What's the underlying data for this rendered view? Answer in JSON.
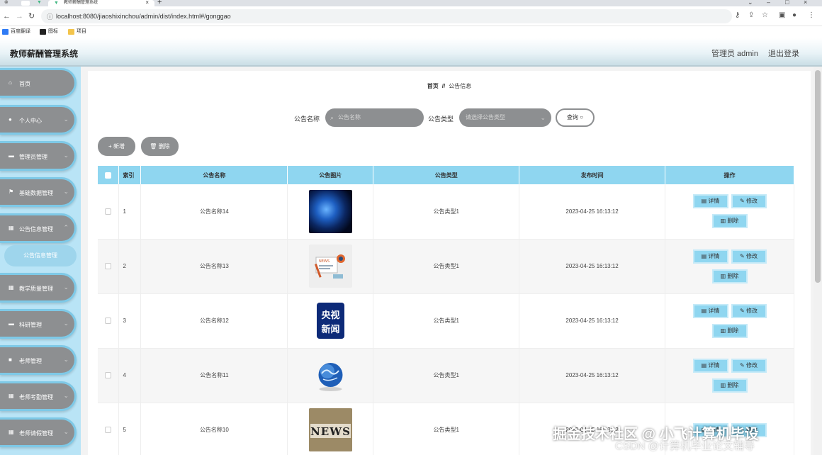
{
  "browser": {
    "tab_title": "教师薪酬管理系统",
    "url": "localhost:8080/jiaoshixinchou/admin/dist/index.html#/gonggao",
    "bookmarks": [
      "百度翻译",
      "图标",
      "项目"
    ]
  },
  "header": {
    "title": "教师薪酬管理系统",
    "admin_label": "管理员 admin",
    "logout_label": "退出登录"
  },
  "sidebar": {
    "items": [
      {
        "label": "首页",
        "icon": "home-icon"
      },
      {
        "label": "个人中心",
        "icon": "user-icon"
      },
      {
        "label": "管理员管理",
        "icon": "monitor-icon"
      },
      {
        "label": "基础数据管理",
        "icon": "flag-icon"
      },
      {
        "label": "公告信息管理",
        "icon": "grid-icon"
      },
      {
        "label": "教学质量管理",
        "icon": "grid-icon"
      },
      {
        "label": "科研管理",
        "icon": "monitor-icon"
      },
      {
        "label": "老师管理",
        "icon": "briefcase-icon"
      },
      {
        "label": "老师考勤管理",
        "icon": "grid-icon"
      },
      {
        "label": "老师请假管理",
        "icon": "grid-icon"
      }
    ],
    "active_sub": "公告信息管理"
  },
  "breadcrumb": {
    "home": "首页",
    "sep": "//",
    "current": "公告信息"
  },
  "search": {
    "name_label": "公告名称",
    "name_placeholder": "公告名称",
    "type_label": "公告类型",
    "type_placeholder": "请选择公告类型",
    "query_label": "查询"
  },
  "actions": {
    "add_label": "新增",
    "delete_label": "删除"
  },
  "table": {
    "headers": [
      "索引",
      "公告名称",
      "公告图片",
      "公告类型",
      "发布时间",
      "操作"
    ],
    "rows": [
      {
        "index": "1",
        "name": "公告名称14",
        "image": "globe",
        "type": "公告类型1",
        "time": "2023-04-25 16:13:12"
      },
      {
        "index": "2",
        "name": "公告名称13",
        "image": "news-paper",
        "type": "公告类型1",
        "time": "2023-04-25 16:13:12"
      },
      {
        "index": "3",
        "name": "公告名称12",
        "image": "cctv-news",
        "type": "公告类型1",
        "time": "2023-04-25 16:13:12"
      },
      {
        "index": "4",
        "name": "公告名称11",
        "image": "world-globe",
        "type": "公告类型1",
        "time": "2023-04-25 16:13:12"
      },
      {
        "index": "5",
        "name": "公告名称10",
        "image": "news-blocks",
        "type": "公告类型1",
        "time": "2023-04-25 16:13:12"
      }
    ],
    "op_detail": "详情",
    "op_edit": "修改",
    "op_delete": "删除"
  },
  "thumb_text": {
    "paper": "NEWS",
    "cctv_top": "央视",
    "cctv_bottom": "新闻",
    "news_blocks": "NEWS"
  },
  "watermark": {
    "line1": "掘金技术社区 @ 小飞计算机毕设",
    "line2": "CSDN @计算机毕业论文辅导"
  },
  "colors": {
    "accent": "#8fd6f0",
    "sidebar_bg": "#b9e4f6",
    "menu_grey": "#8d8f91"
  }
}
